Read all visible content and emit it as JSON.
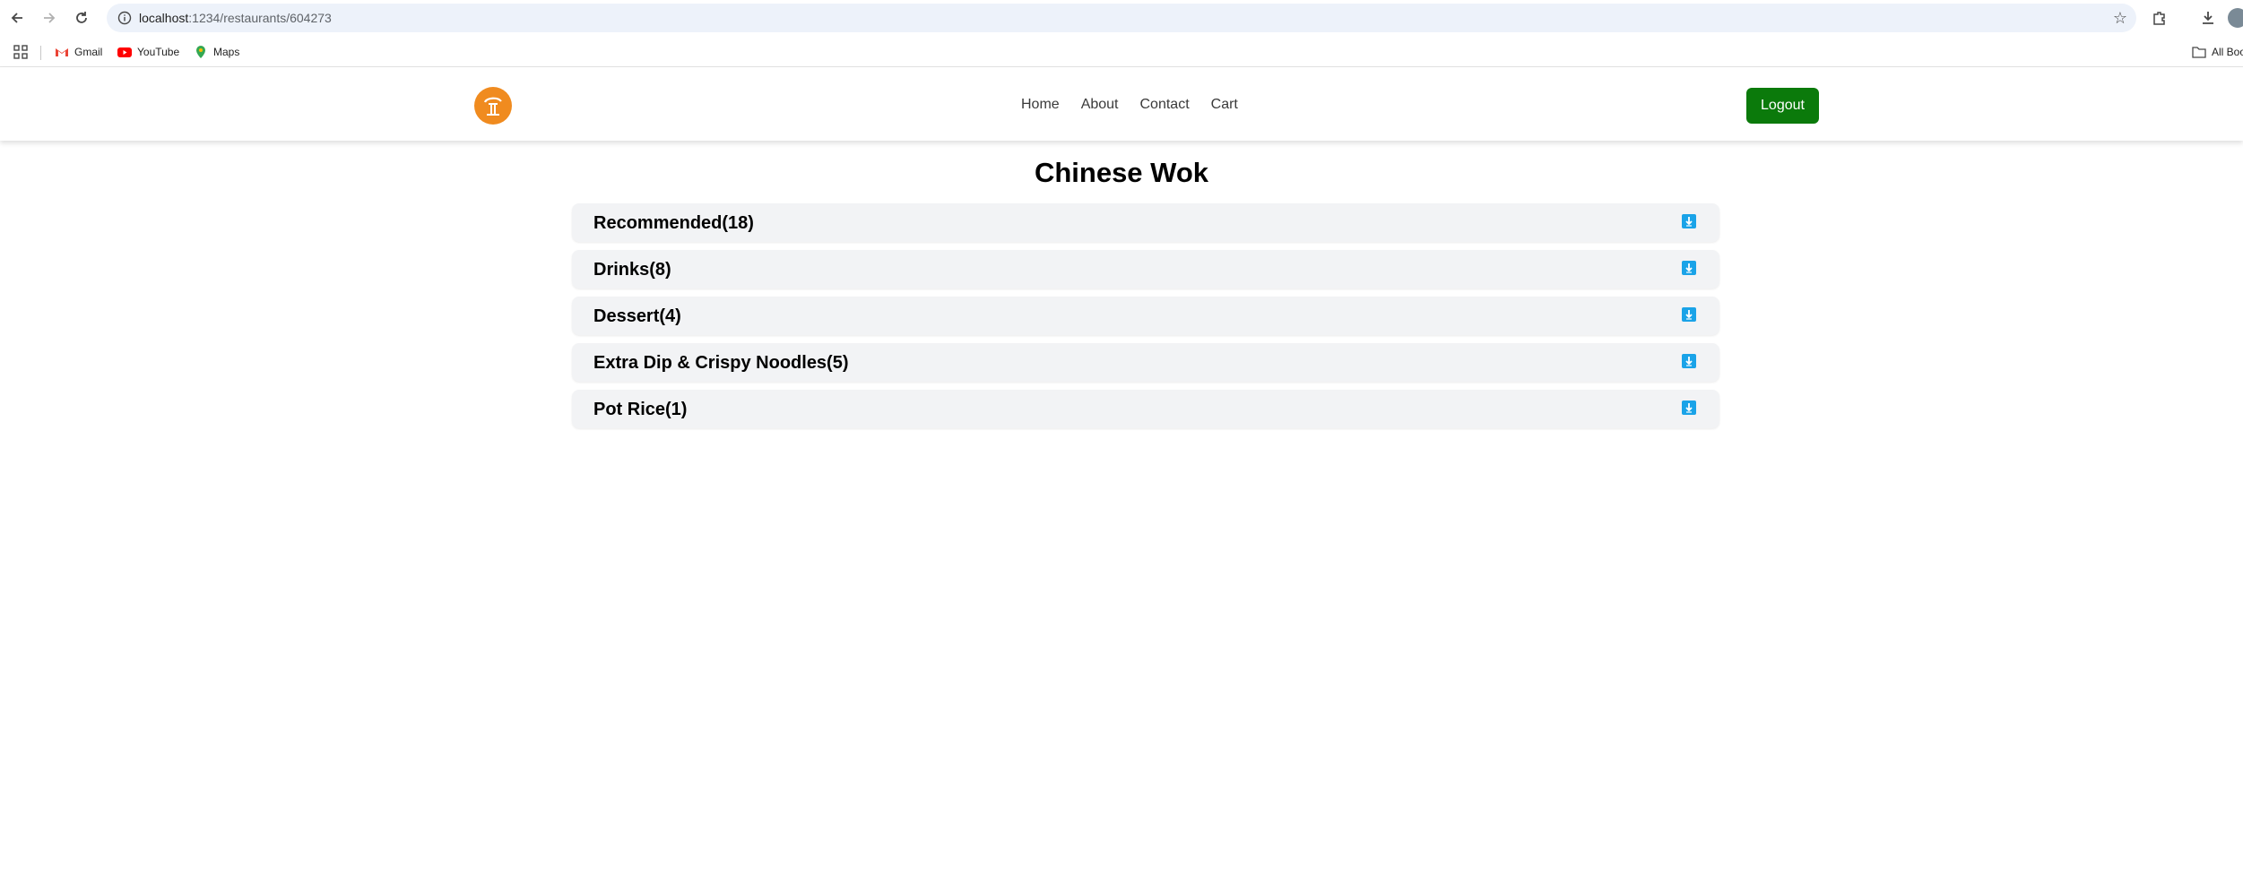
{
  "browser": {
    "url_host": "localhost",
    "url_path": ":1234/restaurants/604273",
    "bookmarks": [
      {
        "label": "Gmail",
        "icon": "gmail-icon"
      },
      {
        "label": "YouTube",
        "icon": "youtube-icon"
      },
      {
        "label": "Maps",
        "icon": "maps-icon"
      }
    ],
    "all_bookmarks_label": "All Boo"
  },
  "header": {
    "logo": "restaurant-logo",
    "nav": [
      "Home",
      "About",
      "Contact",
      "Cart"
    ],
    "logout_label": "Logout"
  },
  "page": {
    "title": "Chinese Wok",
    "categories": [
      {
        "label": "Recommended(18)"
      },
      {
        "label": "Drinks(8)"
      },
      {
        "label": "Dessert(4)"
      },
      {
        "label": "Extra Dip & Crispy Noodles(5)"
      },
      {
        "label": "Pot Rice(1)"
      }
    ]
  },
  "colors": {
    "logout_bg": "#0b7a0b",
    "logo_orange": "#f08b1f",
    "category_bg": "#f2f3f5",
    "arrow_blue": "#1aa3e8"
  }
}
